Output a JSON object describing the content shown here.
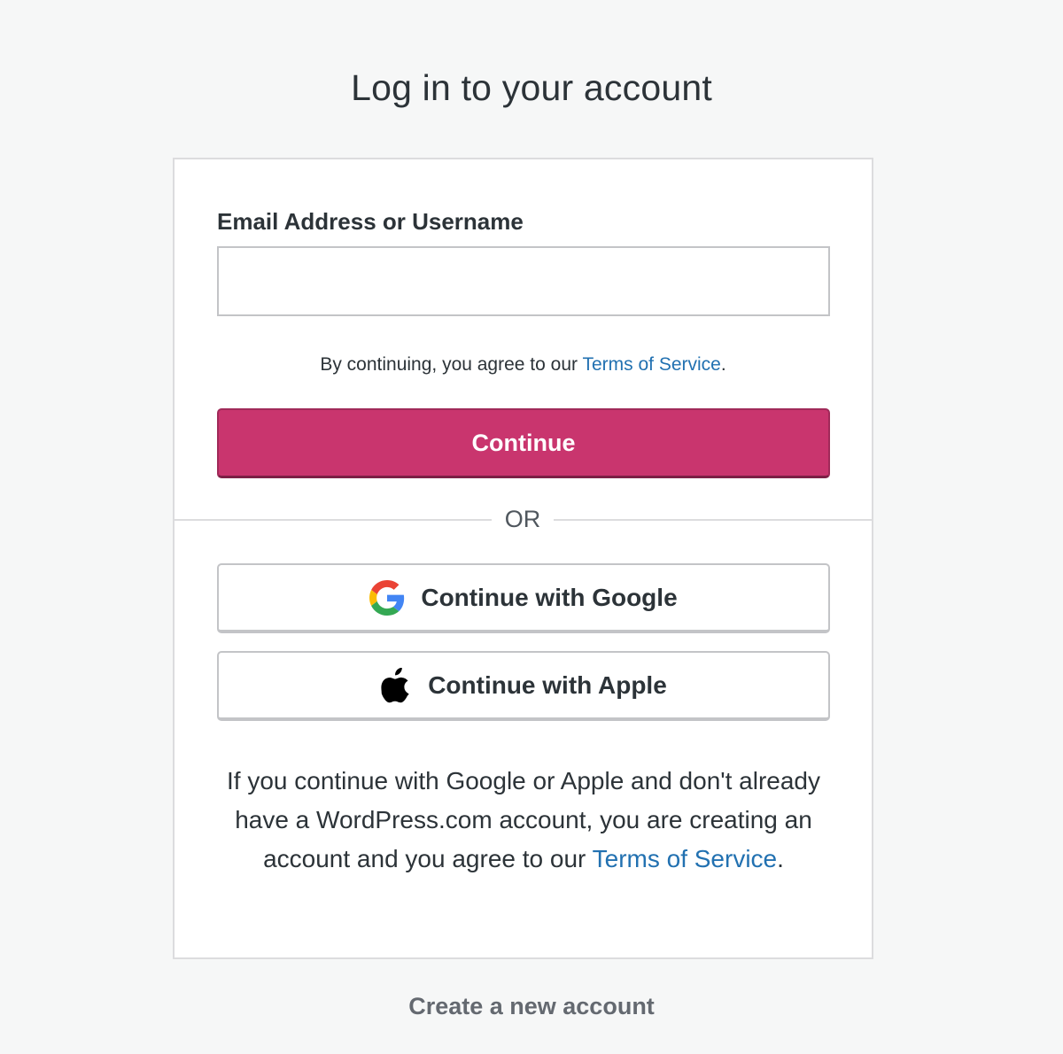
{
  "page": {
    "title": "Log in to your account"
  },
  "form": {
    "email_label": "Email Address or Username",
    "email_value": "",
    "tos_prefix": "By continuing, you agree to our ",
    "tos_link": "Terms of Service",
    "tos_suffix": ".",
    "continue_label": "Continue"
  },
  "divider": {
    "label": "OR"
  },
  "social": {
    "google_label": "Continue with Google",
    "google_icon": "google-icon",
    "apple_label": "Continue with Apple",
    "apple_icon": "apple-icon",
    "note_prefix": "If you continue with Google or Apple and don't already have a WordPress.com account, you are creating an account and you agree to our ",
    "note_link": "Terms of Service",
    "note_suffix": "."
  },
  "footer": {
    "create_account_label": "Create a new account"
  },
  "colors": {
    "primary": "#c9356e",
    "link": "#2271b1",
    "background": "#f6f7f7"
  }
}
